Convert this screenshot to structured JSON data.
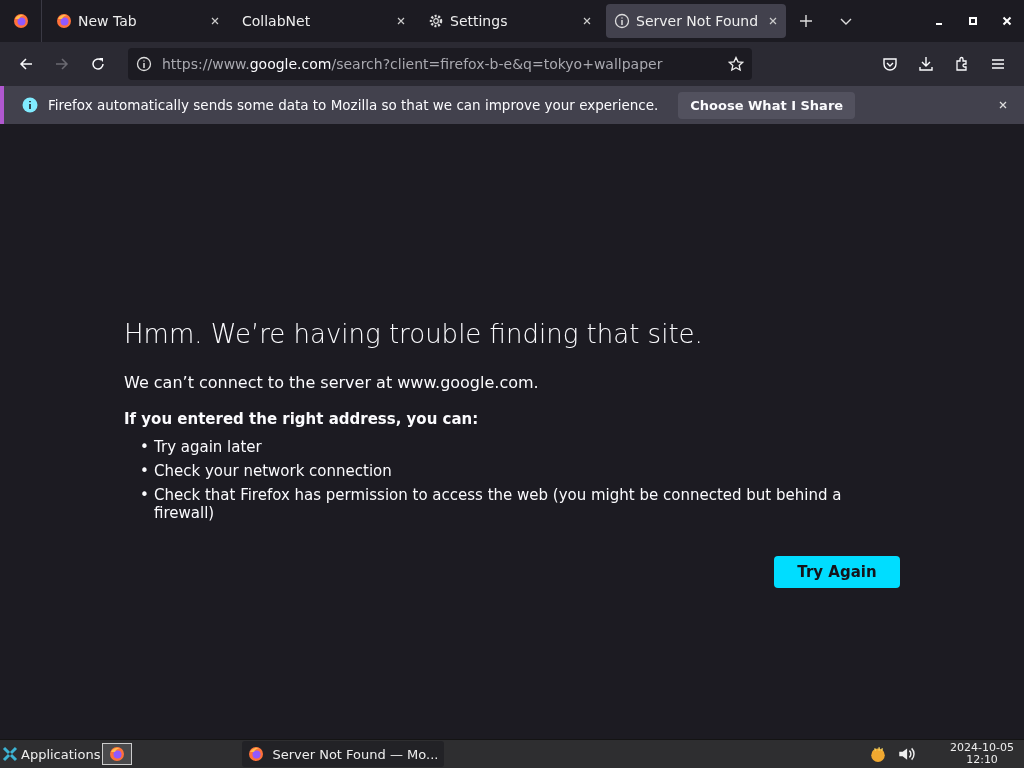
{
  "tabs": [
    {
      "label": "New Tab",
      "kind": "firefox",
      "selected": false
    },
    {
      "label": "CollabNet",
      "kind": "plain",
      "selected": false
    },
    {
      "label": "Settings",
      "kind": "settings",
      "selected": false
    },
    {
      "label": "Server Not Found",
      "kind": "error",
      "selected": true
    }
  ],
  "nav": {
    "back_disabled": false,
    "forward_disabled": true
  },
  "url": {
    "prefix": "https://www.",
    "host": "google.com",
    "path": "/search?client=firefox-b-e&q=tokyo+wallpaper"
  },
  "notification": {
    "message": "Firefox automatically sends some data to Mozilla so that we can improve your experience.",
    "button": "Choose What I Share"
  },
  "error": {
    "title": "Hmm. We’re having trouble finding that site.",
    "message": "We can’t connect to the server at www.google.com.",
    "subtitle": "If you entered the right address, you can:",
    "suggestions": [
      {
        "bullet": "•",
        "text": "Try again later"
      },
      {
        "bullet": "•",
        "text": "Check your network connection"
      },
      {
        "bullet": "•",
        "text": "Check that Firefox has permission to access the web (you might be connected but behind a firewall)"
      }
    ],
    "button": "Try Again"
  },
  "taskbar": {
    "menu": "Applications",
    "window": "Server Not Found — Mo...",
    "date": "2024-10-05",
    "time": "12:10"
  }
}
